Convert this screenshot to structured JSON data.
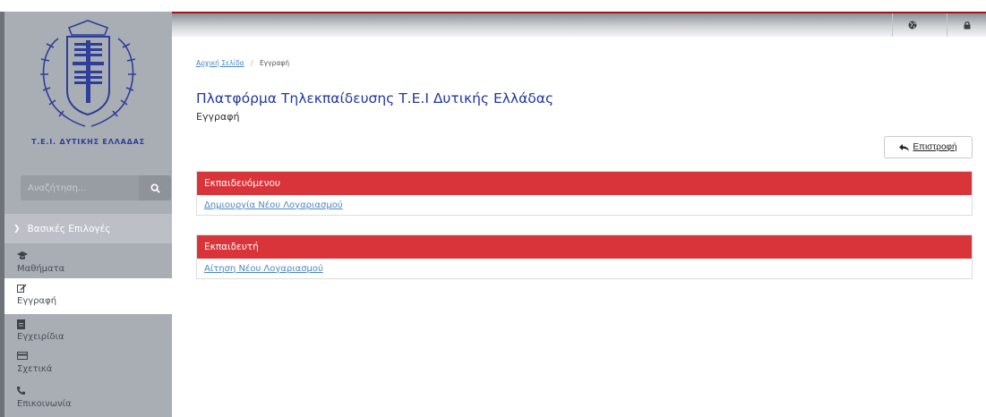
{
  "sidebar": {
    "logo_caption": "Τ.Ε.Ι. ΔΥΤΙΚΗΣ ΕΛΛΑΔΑΣ",
    "search": {
      "placeholder": "Αναζήτηση...",
      "icon": "search-icon"
    },
    "section_header": "Βασικές Επιλογές",
    "items": [
      {
        "label": "Μαθήματα",
        "icon": "graduation-cap-icon",
        "active": false
      },
      {
        "label": "Εγγραφή",
        "icon": "edit-icon",
        "active": true
      },
      {
        "label": "Εγχειρίδια",
        "icon": "file-icon",
        "active": false
      },
      {
        "label": "Σχετικά",
        "icon": "credit-card-icon",
        "active": false
      },
      {
        "label": "Επικοινωνία",
        "icon": "phone-icon",
        "active": false
      }
    ]
  },
  "topbar": {
    "icons": [
      "globe-icon",
      "lock-icon"
    ]
  },
  "breadcrumb": {
    "home": "Αρχική Σελίδα",
    "separator": "/",
    "current": "Εγγραφή"
  },
  "page": {
    "title": "Πλατφόρμα Τηλεκπαίδευσης Τ.Ε.Ι Δυτικής Ελλάδας",
    "subtitle": "Εγγραφή",
    "back_label": "Επιστροφή"
  },
  "panels": [
    {
      "heading": "Εκπαιδευόμενου",
      "link": "Δημιουργία Νέου Λογαριασμού"
    },
    {
      "heading": "Εκπαιδευτή",
      "link": "Αίτηση Νέου Λογαριασμού"
    }
  ],
  "colors": {
    "accent_red": "#d9343a",
    "title_blue": "#2237a0",
    "link_blue": "#4a86c5",
    "sidebar_bg": "#a9adb4"
  }
}
